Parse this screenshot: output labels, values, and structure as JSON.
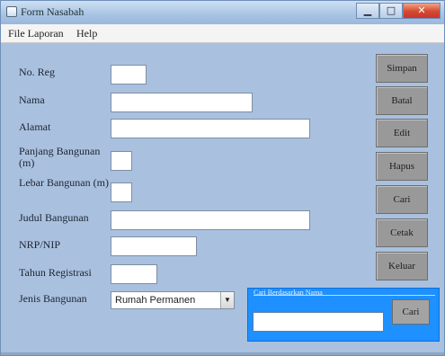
{
  "window": {
    "title": "Form Nasabah",
    "controls": {
      "minimize": "▁",
      "maximize": "□",
      "close": "✕"
    }
  },
  "menubar": {
    "items": [
      {
        "label": "File  Laporan"
      },
      {
        "label": "Help"
      }
    ]
  },
  "form": {
    "fields": [
      {
        "key": "no_reg",
        "label": "No. Reg",
        "value": ""
      },
      {
        "key": "nama",
        "label": "Nama",
        "value": ""
      },
      {
        "key": "alamat",
        "label": "Alamat",
        "value": ""
      },
      {
        "key": "panjang",
        "label": "Panjang Bangunan (m)",
        "value": ""
      },
      {
        "key": "lebar",
        "label": "Lebar Bangunan (m)",
        "value": ""
      },
      {
        "key": "judul",
        "label": "Judul Bangunan",
        "value": ""
      },
      {
        "key": "nrp",
        "label": "NRP/NIP",
        "value": ""
      },
      {
        "key": "tahun",
        "label": "Tahun Registrasi",
        "value": ""
      }
    ],
    "jenis": {
      "label": "Jenis Bangunan",
      "selected": "Rumah Permanen"
    }
  },
  "buttons": {
    "simpan": "Simpan",
    "batal": "Batal",
    "edit": "Edit",
    "hapus": "Hapus",
    "cari": "Cari",
    "cetak": "Cetak",
    "keluar": "Keluar"
  },
  "search": {
    "legend": "Cari Berdasarkan Nama",
    "button": "Cari",
    "value": ""
  }
}
